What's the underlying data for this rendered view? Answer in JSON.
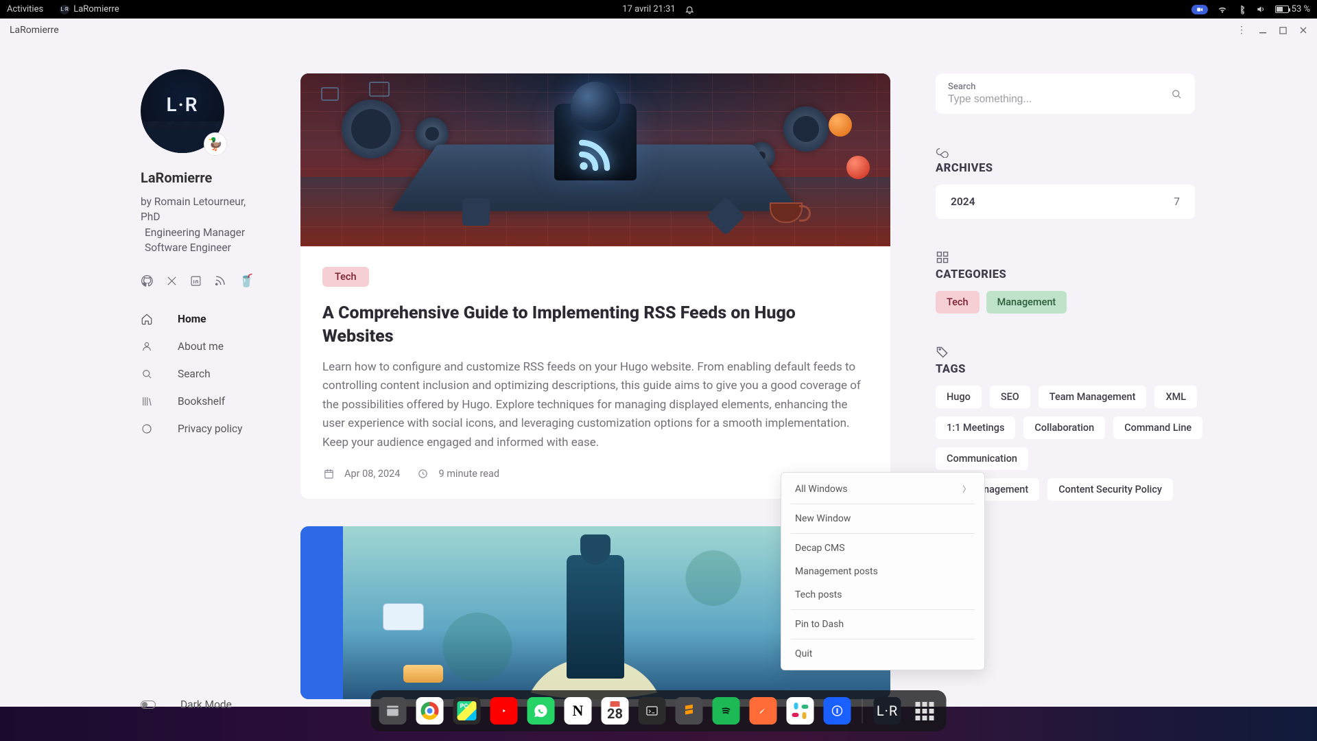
{
  "topbar": {
    "activities": "Activities",
    "app_name": "LaRomierre",
    "datetime": "17 avril  21:31",
    "battery": "53 %"
  },
  "window": {
    "title": "LaRomierre"
  },
  "sidebar": {
    "avatar_initials": "L·R",
    "avatar_badge": "🦆",
    "site_title": "LaRomierre",
    "byline1": "by Romain Letourneur, PhD",
    "byline2": "Engineering Manager",
    "byline3": "Software Engineer",
    "nav": [
      {
        "label": "Home"
      },
      {
        "label": "About me"
      },
      {
        "label": "Search"
      },
      {
        "label": "Bookshelf"
      },
      {
        "label": "Privacy policy"
      }
    ],
    "dark_mode": "Dark Mode"
  },
  "post": {
    "tag": "Tech",
    "title": "A Comprehensive Guide to Implementing RSS Feeds on Hugo Websites",
    "body": "Learn how to configure and customize RSS feeds on your Hugo website. From enabling default feeds to controlling content inclusion and optimizing descriptions, this guide aims to give you a good coverage of the possibilities offered by Hugo. Explore techniques for managing displayed elements, enhancing the user experience with social icons, and leveraging customization options for a smooth implementation. Keep your audience engaged and informed with ease.",
    "date": "Apr 08, 2024",
    "read": "9 minute read"
  },
  "search": {
    "label": "Search",
    "placeholder": "Type something..."
  },
  "archives": {
    "heading": "ARCHIVES",
    "year": "2024",
    "count": "7"
  },
  "categories": {
    "heading": "CATEGORIES",
    "items": [
      {
        "label": "Tech",
        "cls": "tech"
      },
      {
        "label": "Management",
        "cls": "mgmt"
      }
    ]
  },
  "tags": {
    "heading": "TAGS",
    "items": [
      "Hugo",
      "SEO",
      "Team Management",
      "XML",
      "1:1 Meetings",
      "Collaboration",
      "Command Line",
      "Communication"
    ],
    "partial_right": "nagement",
    "last": "Content Security Policy"
  },
  "context_menu": {
    "all_windows": "All Windows",
    "new_window": "New Window",
    "items": [
      "Decap CMS",
      "Management posts",
      "Tech posts"
    ],
    "pin": "Pin to Dash",
    "quit": "Quit"
  },
  "dock": {
    "cal_day": "28"
  }
}
